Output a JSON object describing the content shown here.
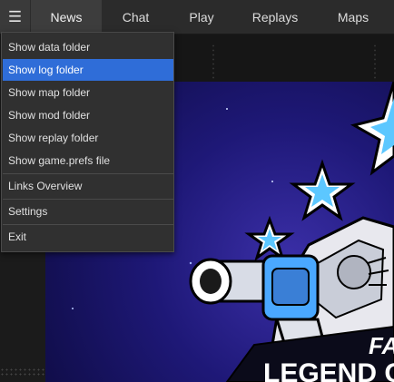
{
  "nav": {
    "menu_icon": "☰",
    "tabs": [
      {
        "label": "News",
        "active": true
      },
      {
        "label": "Chat",
        "active": false
      },
      {
        "label": "Play",
        "active": false
      },
      {
        "label": "Replays",
        "active": false
      },
      {
        "label": "Maps",
        "active": false
      }
    ]
  },
  "menu": {
    "items": [
      {
        "label": "Show data folder",
        "highlighted": false
      },
      {
        "label": "Show log folder",
        "highlighted": true
      },
      {
        "label": "Show map folder",
        "highlighted": false
      },
      {
        "label": "Show mod folder",
        "highlighted": false
      },
      {
        "label": "Show replay folder",
        "highlighted": false
      },
      {
        "label": "Show game.prefs file",
        "highlighted": false
      },
      {
        "label": "Links Overview",
        "highlighted": false
      },
      {
        "label": "Settings",
        "highlighted": false
      },
      {
        "label": "Exit",
        "highlighted": false
      }
    ]
  },
  "hero": {
    "banner_text": "LEGEND OF",
    "corner_text": "FA"
  },
  "colors": {
    "accent": "#2f6dd8",
    "topbar": "#2b2b2b",
    "menu_bg": "#303030",
    "hero_bg": "#1e1877"
  }
}
